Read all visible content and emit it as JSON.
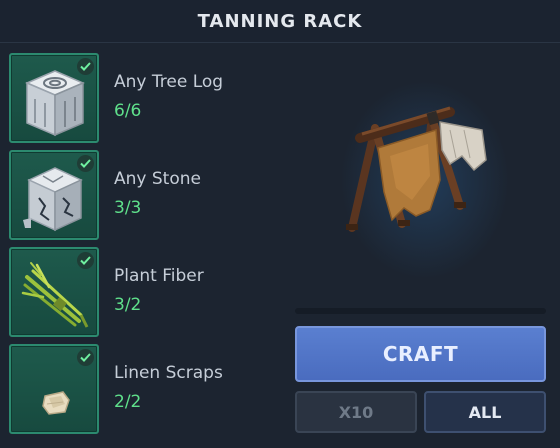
{
  "header": {
    "title": "TANNING RACK"
  },
  "requirements": [
    {
      "name": "Any Tree Log",
      "count": "6/6",
      "icon": "tree-log-icon",
      "fulfilled": true
    },
    {
      "name": "Any Stone",
      "count": "3/3",
      "icon": "stone-icon",
      "fulfilled": true
    },
    {
      "name": "Plant Fiber",
      "count": "3/2",
      "icon": "plant-fiber-icon",
      "fulfilled": true
    },
    {
      "name": "Linen Scraps",
      "count": "2/2",
      "icon": "linen-scraps-icon",
      "fulfilled": true
    }
  ],
  "preview": {
    "item": "tanning-rack",
    "progress": 0
  },
  "actions": {
    "craft_label": "CRAFT",
    "x10_label": "X10",
    "all_label": "ALL"
  },
  "colors": {
    "accent_green": "#5fe08b",
    "craft_blue": "#4a6cbf",
    "slot_bg": "#174a3f"
  }
}
